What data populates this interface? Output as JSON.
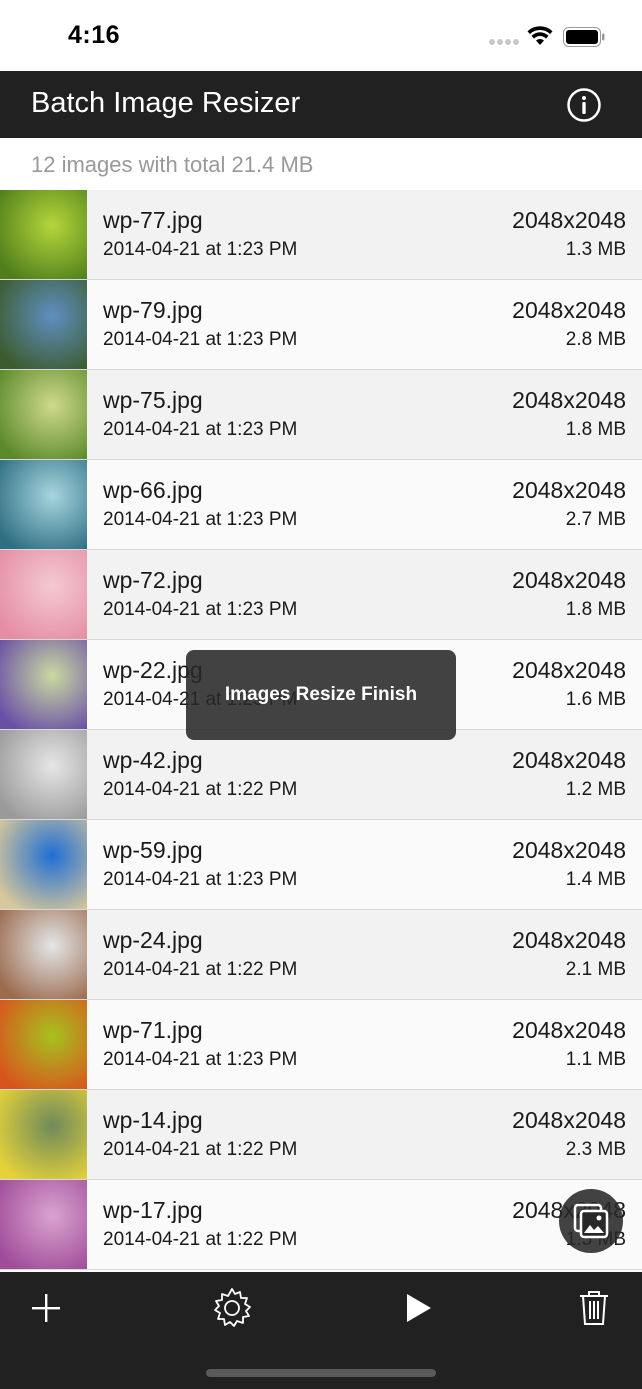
{
  "status_bar": {
    "time": "4:16"
  },
  "nav": {
    "title": "Batch Image Resizer",
    "info_icon": "info-circle-icon"
  },
  "summary": {
    "text": "12 images with total 21.4 MB"
  },
  "images": [
    {
      "name": "wp-77.jpg",
      "date": "2014-04-21 at 1:23 PM",
      "dims": "2048x2048",
      "size": "1.3 MB",
      "thumb_colors": [
        "#b5d63a",
        "#4f7e1c"
      ]
    },
    {
      "name": "wp-79.jpg",
      "date": "2014-04-21 at 1:23 PM",
      "dims": "2048x2048",
      "size": "2.8 MB",
      "thumb_colors": [
        "#5e8fc0",
        "#3c5b2e"
      ]
    },
    {
      "name": "wp-75.jpg",
      "date": "2014-04-21 at 1:23 PM",
      "dims": "2048x2048",
      "size": "1.8 MB",
      "thumb_colors": [
        "#cfd98c",
        "#5b8a2a"
      ]
    },
    {
      "name": "wp-66.jpg",
      "date": "2014-04-21 at 1:23 PM",
      "dims": "2048x2048",
      "size": "2.7 MB",
      "thumb_colors": [
        "#a7d6de",
        "#2f6f84"
      ]
    },
    {
      "name": "wp-72.jpg",
      "date": "2014-04-21 at 1:23 PM",
      "dims": "2048x2048",
      "size": "1.8 MB",
      "thumb_colors": [
        "#f4c9d2",
        "#e58ea3"
      ]
    },
    {
      "name": "wp-22.jpg",
      "date": "2014-04-21 at 1:23 PM",
      "dims": "2048x2048",
      "size": "1.6 MB",
      "thumb_colors": [
        "#c9d9a0",
        "#6a4fa6"
      ]
    },
    {
      "name": "wp-42.jpg",
      "date": "2014-04-21 at 1:22 PM",
      "dims": "2048x2048",
      "size": "1.2 MB",
      "thumb_colors": [
        "#e6e6e6",
        "#9a9a9a"
      ]
    },
    {
      "name": "wp-59.jpg",
      "date": "2014-04-21 at 1:23 PM",
      "dims": "2048x2048",
      "size": "1.4 MB",
      "thumb_colors": [
        "#1f6fd6",
        "#d7c79a"
      ]
    },
    {
      "name": "wp-24.jpg",
      "date": "2014-04-21 at 1:22 PM",
      "dims": "2048x2048",
      "size": "2.1 MB",
      "thumb_colors": [
        "#e3e6e8",
        "#9c6b4e"
      ]
    },
    {
      "name": "wp-71.jpg",
      "date": "2014-04-21 at 1:23 PM",
      "dims": "2048x2048",
      "size": "1.1 MB",
      "thumb_colors": [
        "#a6c21e",
        "#d8541e"
      ]
    },
    {
      "name": "wp-14.jpg",
      "date": "2014-04-21 at 1:22 PM",
      "dims": "2048x2048",
      "size": "2.3 MB",
      "thumb_colors": [
        "#6f8a5a",
        "#e5d23a"
      ]
    },
    {
      "name": "wp-17.jpg",
      "date": "2014-04-21 at 1:22 PM",
      "dims": "2048x2048",
      "size": "1.5 MB",
      "thumb_colors": [
        "#d9a3cf",
        "#a04c9a"
      ]
    }
  ],
  "toast": {
    "text": "Images Resize Finish"
  },
  "fab": {
    "icon": "image-stack-icon"
  },
  "toolbar": {
    "buttons": [
      {
        "icon": "plus-icon"
      },
      {
        "icon": "gear-icon"
      },
      {
        "icon": "play-icon"
      },
      {
        "icon": "trash-icon"
      }
    ]
  },
  "colors": {
    "nav_bg": "#212121",
    "row_even": "#f2f2f2",
    "row_odd": "#fafafa",
    "summary_text": "#999999"
  }
}
